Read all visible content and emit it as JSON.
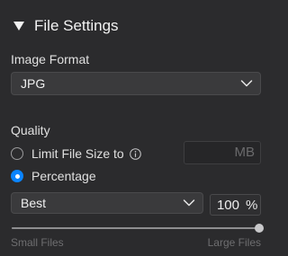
{
  "section": {
    "title": "File Settings"
  },
  "image_format": {
    "label": "Image Format",
    "selected": "JPG"
  },
  "quality": {
    "label": "Quality",
    "limit_option": {
      "label": "Limit File Size to",
      "selected": false,
      "size_value": "",
      "size_unit": "MB"
    },
    "percentage_option": {
      "label": "Percentage",
      "selected": true
    },
    "preset": {
      "selected": "Best"
    },
    "percent_value": "100",
    "percent_unit": "%",
    "slider": {
      "level_percent": 100,
      "min_label": "Small Files",
      "max_label": "Large Files"
    }
  },
  "colors": {
    "background": "#2b2b2d",
    "accent": "#0a84ff"
  }
}
